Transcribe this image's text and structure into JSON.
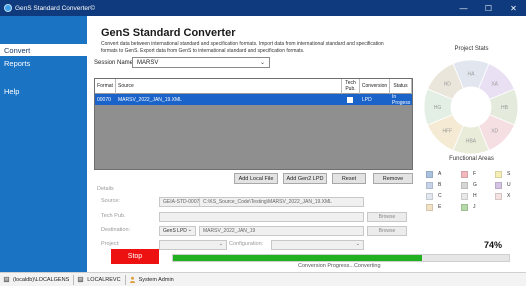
{
  "window": {
    "title": "GenS Standard Converter©",
    "minimize": "—",
    "maximize": "☐",
    "close": "✕"
  },
  "sidebar": {
    "items": [
      {
        "label": "Convert"
      },
      {
        "label": "Reports"
      },
      {
        "label": "Help"
      }
    ]
  },
  "header": {
    "title": "GenS Standard Converter",
    "description": "Convert data between international standard and specification formats. Import data from international standard and specification formats to GenS. Export data from GenS to international standard and specification formats."
  },
  "session": {
    "label": "Session Name:",
    "value": "MARSV"
  },
  "grid": {
    "columns": {
      "format": "Format",
      "source": "Source",
      "tech_pub": "Tech Pub.",
      "conversion": "Conversion",
      "status": "Status"
    },
    "rows": [
      {
        "format": "00070",
        "source": "MARSV_2022_JAN_19.XML",
        "tech_pub": false,
        "conversion": "LPD",
        "status": "In Progess"
      }
    ]
  },
  "buttons": {
    "add_local": "Add Local File",
    "add_gens2": "Add Gen2 LPD",
    "reset": "Reset",
    "remove": "Remove",
    "browse": "Browse",
    "stop": "Stop"
  },
  "details": {
    "label": "Details",
    "source_label": "Source:",
    "source_format": "GEIA-STD-00070",
    "source_path": "C:\\KS_Source_Code\\Testing\\MARSV_2022_JAN_19.XML",
    "tech_pub_label": "Tech Pub.",
    "destination_label": "Destination:",
    "destination_format": "GenS LPD",
    "destination_name": "MARSV_2022_JAN_19",
    "project_label": "Project:",
    "configuration_label": "Configuration:"
  },
  "progress": {
    "percent_label": "74%",
    "value": 0.74,
    "text": "Conversion Progress...Converting"
  },
  "project_stats": {
    "title": "Project Stats",
    "segments": [
      {
        "label": "HA",
        "color": "#e2e6ee"
      },
      {
        "label": "XA",
        "color": "#e9e0f3"
      },
      {
        "label": "HB",
        "color": "#e4ebdd"
      },
      {
        "label": "XD",
        "color": "#f6dfe3"
      },
      {
        "label": "HBA",
        "color": "#e8ecd9"
      },
      {
        "label": "HFF",
        "color": "#f5ead3"
      },
      {
        "label": "HG",
        "color": "#e3efe4"
      },
      {
        "label": "HD",
        "color": "#ebe6dc"
      }
    ]
  },
  "functional_areas": {
    "title": "Functional Areas",
    "items": [
      {
        "label": "A",
        "color": "#a9c2df"
      },
      {
        "label": "F",
        "color": "#f2b8be"
      },
      {
        "label": "S",
        "color": "#f7eeb5"
      },
      {
        "label": "B",
        "color": "#c7d3e8"
      },
      {
        "label": "G",
        "color": "#d6d6d6"
      },
      {
        "label": "U",
        "color": "#d4c3e3"
      },
      {
        "label": "C",
        "color": "#e2e6ee"
      },
      {
        "label": "H",
        "color": "#e8e8e8"
      },
      {
        "label": "X",
        "color": "#f4e1e1"
      },
      {
        "label": "E",
        "color": "#f1e2c4"
      },
      {
        "label": "J",
        "color": "#b6d9a8"
      }
    ]
  },
  "statusbar": {
    "server": "(localdb)\\LOCALGENS",
    "database": "LOCALREVC",
    "user": "System Admin"
  },
  "colors": {
    "titlebar": "#0f3a7d",
    "sidebar": "#1b73c4",
    "selection": "#1a63c9",
    "stop": "#ee1111",
    "progress": "#20b020"
  }
}
